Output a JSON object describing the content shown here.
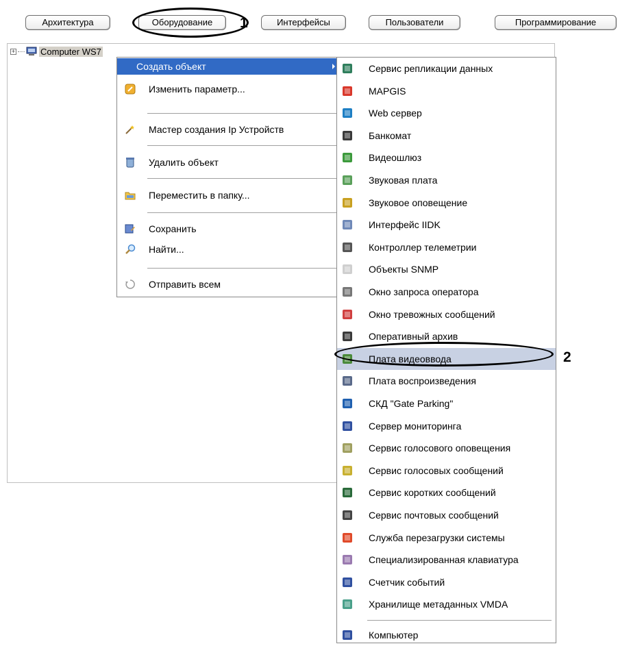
{
  "tabs": [
    {
      "label": "Архитектура"
    },
    {
      "label": "Оборудование"
    },
    {
      "label": "Интерфейсы"
    },
    {
      "label": "Пользователи"
    },
    {
      "label": "Программирование"
    }
  ],
  "callouts": {
    "one": "1",
    "two": "2"
  },
  "tree": {
    "root_label": "Computer WS7",
    "expander": "+"
  },
  "context_menu": {
    "items": [
      {
        "label": "Создать объект",
        "icon": "none",
        "highlighted": true,
        "has_submenu": true
      },
      {
        "label": "Изменить параметр...",
        "icon": "edit-param-icon"
      },
      {
        "label": "Мастер создания Ip Устройств",
        "icon": "wizard-icon"
      },
      {
        "label": "Удалить объект",
        "icon": "delete-icon"
      },
      {
        "label": "Переместить в папку...",
        "icon": "folder-icon"
      },
      {
        "label": "Сохранить",
        "icon": "save-icon"
      },
      {
        "label": "Найти...",
        "icon": "search-icon"
      },
      {
        "label": "Отправить всем",
        "icon": "broadcast-icon"
      }
    ]
  },
  "submenu": {
    "items": [
      {
        "label": "Сервис репликации данных",
        "icon": "replication-icon",
        "color": "#2f7e5c"
      },
      {
        "label": "MAPGIS",
        "icon": "map-icon",
        "color": "#d9382b"
      },
      {
        "label": "Web сервер",
        "icon": "globe-icon",
        "color": "#1e7fc4"
      },
      {
        "label": "Банкомат",
        "icon": "atm-icon",
        "color": "#3a3a3a"
      },
      {
        "label": "Видеошлюз",
        "icon": "video-gateway-icon",
        "color": "#3c9a3c"
      },
      {
        "label": "Звуковая плата",
        "icon": "sound-card-icon",
        "color": "#5aa05a"
      },
      {
        "label": "Звуковое оповещение",
        "icon": "sound-alert-icon",
        "color": "#c8a020"
      },
      {
        "label": "Интерфейс IIDK",
        "icon": "iidk-icon",
        "color": "#6f89b8"
      },
      {
        "label": "Контроллер телеметрии",
        "icon": "telemetry-icon",
        "color": "#555555"
      },
      {
        "label": "Объекты SNMP",
        "icon": "snmp-icon",
        "color": "#cfcfcf"
      },
      {
        "label": "Окно запроса оператора",
        "icon": "operator-request-icon",
        "color": "#777777"
      },
      {
        "label": "Окно тревожных сообщений",
        "icon": "alarm-window-icon",
        "color": "#d04040"
      },
      {
        "label": "Оперативный архив",
        "icon": "archive-icon",
        "color": "#3a3a3a"
      },
      {
        "label": "Плата видеоввода",
        "icon": "video-capture-icon",
        "color": "#4a8a3a",
        "highlighted": true
      },
      {
        "label": "Плата воспроизведения",
        "icon": "playback-card-icon",
        "color": "#5a6a8a"
      },
      {
        "label": "СКД \"Gate Parking\"",
        "icon": "gate-parking-icon",
        "color": "#2060b0"
      },
      {
        "label": "Сервер мониторинга",
        "icon": "monitoring-server-icon",
        "color": "#3050a0"
      },
      {
        "label": "Сервис голосового оповещения",
        "icon": "voice-alert-icon",
        "color": "#a0a060"
      },
      {
        "label": "Сервис голосовых сообщений",
        "icon": "voice-messages-icon",
        "color": "#c8b030"
      },
      {
        "label": "Сервис коротких сообщений",
        "icon": "sms-icon",
        "color": "#2a6a3a"
      },
      {
        "label": "Сервис почтовых сообщений",
        "icon": "mail-icon",
        "color": "#444444"
      },
      {
        "label": "Служба перезагрузки системы",
        "icon": "reboot-icon",
        "color": "#e04a2a"
      },
      {
        "label": "Специализированная клавиатура",
        "icon": "keyboard-icon",
        "color": "#9a7ab0"
      },
      {
        "label": "Счетчик событий",
        "icon": "event-counter-icon",
        "color": "#3050a0"
      },
      {
        "label": "Хранилище метаданных VMDA",
        "icon": "vmda-icon",
        "color": "#4aa08a"
      },
      {
        "label": "Компьютер",
        "icon": "computer-icon",
        "color": "#3050a0",
        "separated": true
      }
    ]
  }
}
